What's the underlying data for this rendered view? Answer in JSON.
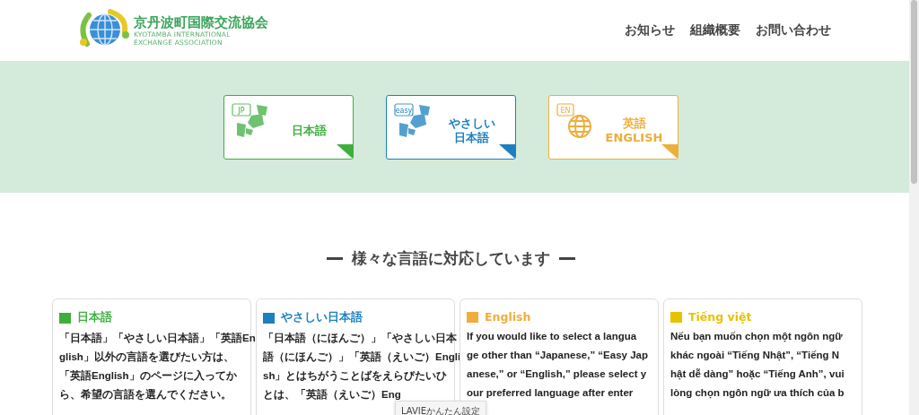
{
  "header": {
    "logo_title": "京丹波町国際交流協会",
    "logo_subtitle": [
      "KYOTAMBA INTERNATIONAL",
      "EXCHANGE ASSOCIATION"
    ],
    "nav": [
      "お知らせ",
      "組織概要",
      "お問い合わせ"
    ]
  },
  "language_buttons": [
    {
      "kind": "jp",
      "badge": "JP",
      "lines": [
        "日本語"
      ],
      "color": "#3fae3f"
    },
    {
      "kind": "easy",
      "badge": "easy",
      "lines": [
        "やさしい",
        "日本語"
      ],
      "color": "#1a80c0"
    },
    {
      "kind": "en",
      "badge": "EN",
      "lines": [
        "英語",
        "ENGLISH"
      ],
      "color": "#eeae3a"
    }
  ],
  "section_title": "様々な言語に対応しています",
  "language_cards": [
    {
      "title": "日本語",
      "color": "#3fae3f",
      "lines": [
        "「日本語」「やさしい日本語」「英語En",
        "glish」以外の言語を選びたい方は、",
        "「英語English」のページに入ってか",
        "ら、希望の言語を選んでください。"
      ]
    },
    {
      "title": "やさしい日本語",
      "color": "#1a80c0",
      "lines": [
        "「日本語（にほんご）」「やさしい日本",
        "語（にほんご）」「英語（えいご）Engli",
        "sh」とはちがうことばをえらびたいひ",
        "とは、「英語（えいご）Eng"
      ]
    },
    {
      "title": "English",
      "color": "#f0ad3c",
      "lines": [
        "If you would like to select a langua",
        "ge other than “Japanese,” “Easy Jap",
        "anese,” or “English,” please select y",
        "our preferred language after enter"
      ]
    },
    {
      "title": "Tiếng việt",
      "color": "#e8c200",
      "lines": [
        "Nếu bạn muốn chọn một ngôn ngữ",
        "khác ngoài “Tiếng Nhật”, “Tiếng N",
        "hật dễ dàng” hoặc “Tiếng Anh”, vui",
        "lòng chọn ngôn ngữ ưa thích của b"
      ]
    }
  ],
  "tooltip": "LAVIEかんたん設定"
}
